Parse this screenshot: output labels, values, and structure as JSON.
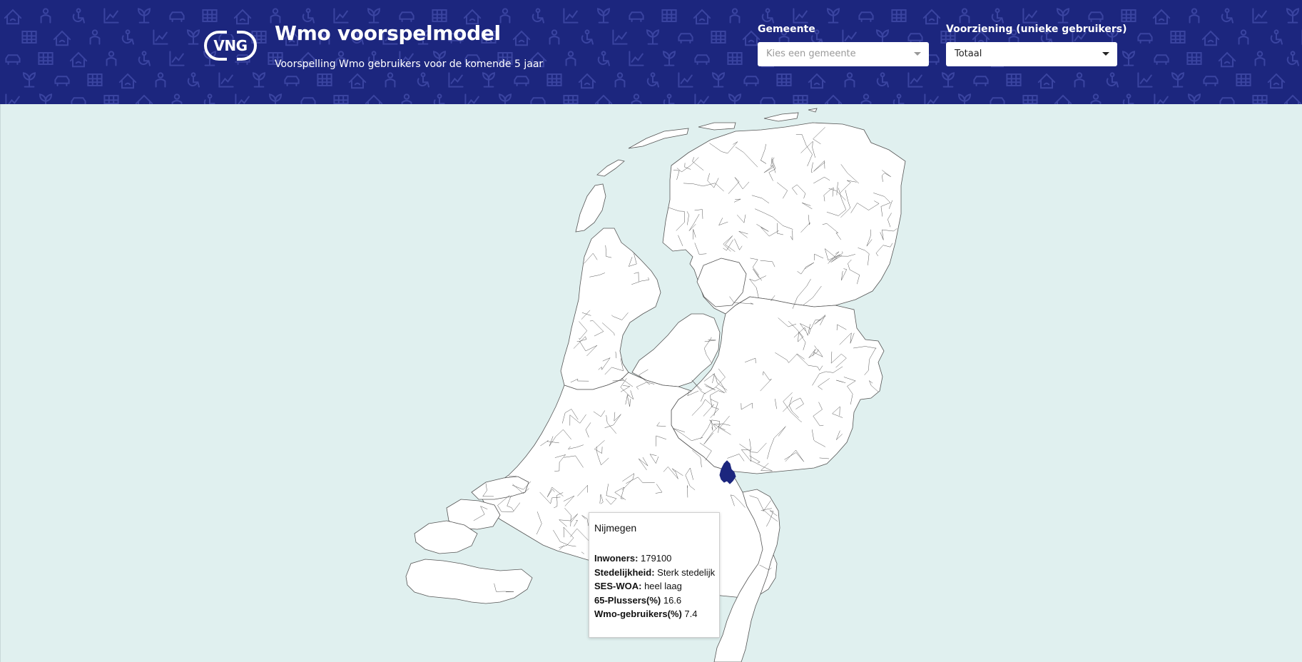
{
  "header": {
    "logo_text": "VNG",
    "title": "Wmo voorspelmodel",
    "subtitle": "Voorspelling Wmo gebruikers voor de komende 5 jaar",
    "background_color": "#1c267e"
  },
  "filters": {
    "gemeente": {
      "label": "Gemeente",
      "placeholder": "Kies een gemeente",
      "value": ""
    },
    "voorziening": {
      "label": "Voorziening (unieke gebruikers)",
      "value": "Totaal"
    }
  },
  "map": {
    "water_color": "#e0f0ef",
    "land_color": "#ffffff",
    "border_color": "#555555",
    "highlight_color": "#1c267e",
    "highlighted_municipality": "Nijmegen"
  },
  "tooltip": {
    "name": "Nijmegen",
    "rows": [
      {
        "label": "Inwoners:",
        "value": "179100"
      },
      {
        "label": "Stedelijkheid:",
        "value": "Sterk stedelijk"
      },
      {
        "label": "SES-WOA:",
        "value": "heel laag"
      },
      {
        "label": "65-Plussers(%)",
        "value": "16.6"
      },
      {
        "label": "Wmo-gebruikers(%)",
        "value": "7.4"
      }
    ]
  },
  "icons": {
    "logo": "vng-logo",
    "dropdown": "chevron-down-icon",
    "header_pattern": [
      "house-icon",
      "person-icon",
      "wheelchair-icon",
      "chart-icon",
      "plant-icon",
      "car-icon",
      "table-icon"
    ]
  }
}
